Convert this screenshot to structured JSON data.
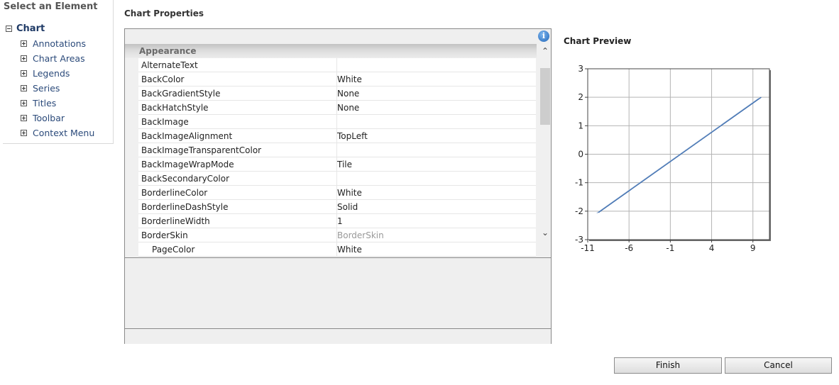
{
  "tree": {
    "heading": "Select an Element",
    "root_label": "Chart",
    "children": [
      "Annotations",
      "Chart Areas",
      "Legends",
      "Series",
      "Titles",
      "Toolbar",
      "Context Menu"
    ]
  },
  "properties": {
    "title": "Chart Properties",
    "category": "Appearance",
    "rows": [
      {
        "name": "AlternateText",
        "value": ""
      },
      {
        "name": "BackColor",
        "value": "White"
      },
      {
        "name": "BackGradientStyle",
        "value": "None"
      },
      {
        "name": "BackHatchStyle",
        "value": "None"
      },
      {
        "name": "BackImage",
        "value": ""
      },
      {
        "name": "BackImageAlignment",
        "value": "TopLeft"
      },
      {
        "name": "BackImageTransparentColor",
        "value": ""
      },
      {
        "name": "BackImageWrapMode",
        "value": "Tile"
      },
      {
        "name": "BackSecondaryColor",
        "value": ""
      },
      {
        "name": "BorderlineColor",
        "value": "White"
      },
      {
        "name": "BorderlineDashStyle",
        "value": "Solid"
      },
      {
        "name": "BorderlineWidth",
        "value": "1"
      },
      {
        "name": "BorderSkin",
        "value": "BorderSkin"
      },
      {
        "name": "PageColor",
        "value": "White"
      }
    ]
  },
  "preview": {
    "title": "Chart Preview"
  },
  "chart_data": {
    "type": "line",
    "title": "",
    "xlabel": "",
    "ylabel": "",
    "xlim": [
      -11,
      11
    ],
    "ylim": [
      -3,
      3
    ],
    "x_ticks": [
      -11,
      -6,
      -1,
      4,
      9
    ],
    "y_ticks": [
      -3,
      -2,
      -1,
      0,
      1,
      2,
      3
    ],
    "grid": true,
    "series": [
      {
        "x": [
          -9.9,
          9.7
        ],
        "y": [
          -2.07,
          1.96
        ],
        "color": "#9fb8d8"
      },
      {
        "x": [
          -9.7,
          10.0
        ],
        "y": [
          -2.05,
          2.0
        ],
        "color": "#3f6fb0"
      }
    ]
  },
  "buttons": {
    "finish": "Finish",
    "cancel": "Cancel"
  },
  "icons": {
    "info": "info-icon",
    "scroll_up": "chevron-up-icon",
    "scroll_down": "chevron-down-icon"
  }
}
